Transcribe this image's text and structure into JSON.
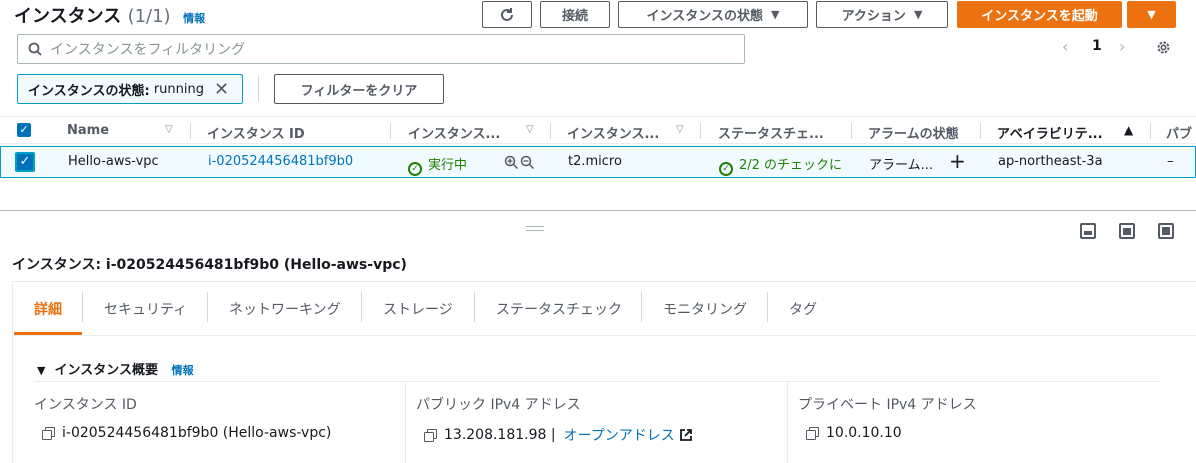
{
  "header": {
    "title": "インスタンス",
    "count": "(1/1)",
    "info": "情報",
    "connect": "接続",
    "instance_state": "インスタンスの状態",
    "actions": "アクション",
    "launch": "インスタンスを起動"
  },
  "search": {
    "placeholder": "インスタンスをフィルタリング"
  },
  "pager": {
    "page": "1"
  },
  "filter": {
    "key": "インスタンスの状態:",
    "value": "running",
    "clear": "フィルターをクリア"
  },
  "table": {
    "columns": [
      "Name",
      "インスタンス ID",
      "インスタンス...",
      "インスタンス...",
      "ステータスチェ...",
      "アラームの状態",
      "アベイラビリテ...",
      "パブ"
    ],
    "row": {
      "name": "Hello-aws-vpc",
      "instance_id": "i-020524456481bf9b0",
      "state": "実行中",
      "type": "t2.micro",
      "status_check": "2/2 のチェックに",
      "alarm": "アラーム...",
      "az": "ap-northeast-3a",
      "public": "–"
    }
  },
  "detail": {
    "title": "インスタンス: i-020524456481bf9b0 (Hello-aws-vpc)",
    "tabs": [
      "詳細",
      "セキュリティ",
      "ネットワーキング",
      "ストレージ",
      "ステータスチェック",
      "モニタリング",
      "タグ"
    ],
    "section": "インスタンス概要",
    "info": "情報",
    "fields": [
      {
        "label": "インスタンス ID",
        "value": "i-020524456481bf9b0 (Hello-aws-vpc)"
      },
      {
        "label": "パブリック IPv4 アドレス",
        "value": "13.208.181.98 |",
        "link": "オープンアドレス"
      },
      {
        "label": "プライベート IPv4 アドレス",
        "value": "10.0.10.10"
      }
    ]
  },
  "colors": {
    "accent": "#ec7211",
    "link": "#0073bb",
    "success": "#1d8102",
    "selected": "#f1faff"
  }
}
